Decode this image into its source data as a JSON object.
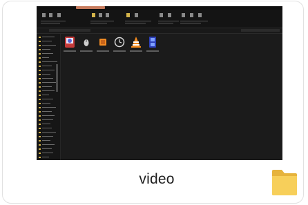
{
  "item": {
    "name": "video",
    "type_icon": "folder-icon",
    "thumbnail_icon": "explorer-window-thumbnail",
    "thumbnail_files": [
      {
        "icon": "media-app-icon"
      },
      {
        "icon": "mouse-icon"
      },
      {
        "icon": "orange-app-icon"
      },
      {
        "icon": "clock-app-icon"
      },
      {
        "icon": "vlc-icon"
      },
      {
        "icon": "film-icon"
      }
    ]
  },
  "colors": {
    "card_border": "#e1e1e1",
    "thumbnail_bg": "#1b1b1b",
    "folder_yellow": "#f4c64e",
    "caption": "#1f1f1f"
  }
}
